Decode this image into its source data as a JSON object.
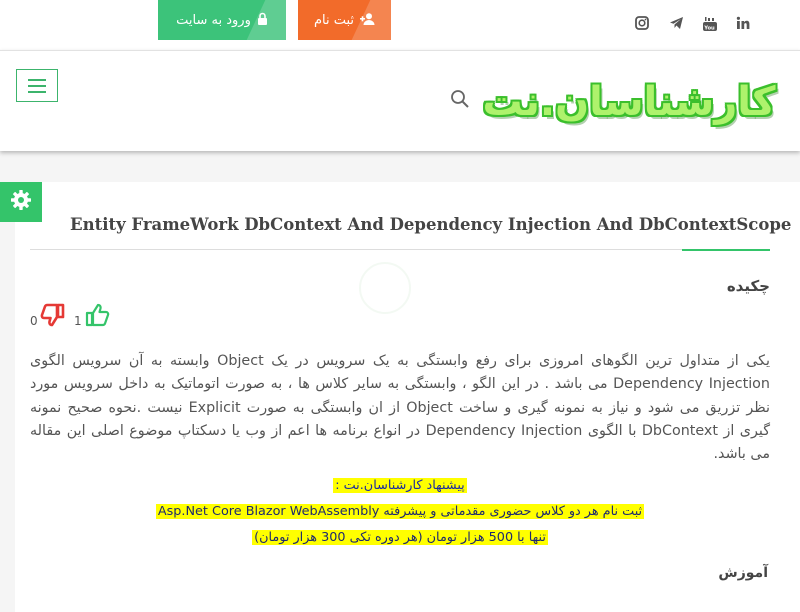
{
  "top": {
    "login_label": "ورود به سایت",
    "register_label": "ثبت نام",
    "social": [
      "instagram-icon",
      "telegram-icon",
      "youtube-icon",
      "linkedin-icon"
    ]
  },
  "header": {
    "logo_text": "کارشناسان.نت"
  },
  "article": {
    "title": "Entity FrameWork DbContext And Dependency Injection And DbContextScope",
    "abstract_heading": "چکیده",
    "likes": "1",
    "dislikes": "0",
    "body": "یکی از متداول ترین الگوهای امروزی برای رفع وابستگی به یک سرویس در یک Object وابسته به آن سرویس الگوی Dependency Injection می باشد . در این الگو ، وابستگی به سایر کلاس ها ، به صورت اتوماتیک به داخل سرویس مورد نظر تزریق می شود و نیاز به نمونه گیری و ساخت Object از ان وابستگی به صورت Explicit نیست .نحوه صحیح نمونه گیری از DbContext با الگوی Dependency Injection در انواع برنامه ها اعم از وب یا دسکتاپ موضوع اصلی این مقاله می باشد.",
    "promo_line1": "پیشنهاد کارشناسان.نت :",
    "promo_line2": "ثبت نام هر دو کلاس حضوری مقدماتی و پیشرفته Asp.Net Core Blazor WebAssembly",
    "promo_line3": "تنها با 500 هزار تومان (هر دوره تکی 300 هزار تومان)",
    "education_heading": "آموزش"
  },
  "colors": {
    "login_bg": "#3cc37a",
    "register_bg": "#f26b2a",
    "accent": "#34c46a",
    "logo_fill": "#aef26c",
    "like": "#34c46a",
    "dislike": "#e53935"
  }
}
